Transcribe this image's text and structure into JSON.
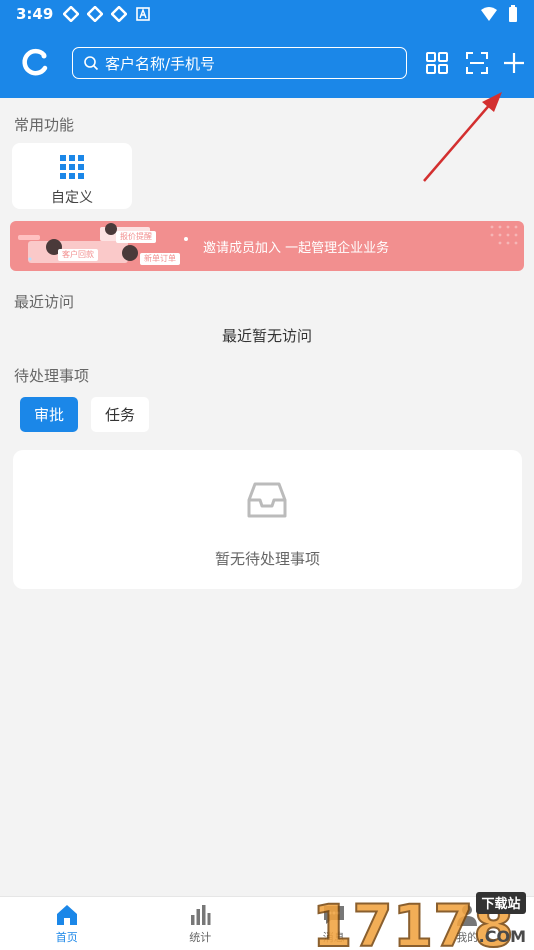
{
  "status_bar": {
    "time": "3:49"
  },
  "header": {
    "search_placeholder": "客户名称/手机号"
  },
  "common": {
    "title": "常用功能",
    "custom_label": "自定义"
  },
  "banner": {
    "text": "邀请成员加入  一起管理企业业务",
    "tag1": "报价提醒",
    "tag2": "客户回款",
    "tag3": "新单订单"
  },
  "recent": {
    "title": "最近访问",
    "empty_text": "最近暂无访问"
  },
  "pending": {
    "title": "待处理事项",
    "tabs": [
      {
        "label": "审批"
      },
      {
        "label": "任务"
      }
    ],
    "empty_text": "暂无待处理事项"
  },
  "nav": {
    "items": [
      {
        "label": "首页"
      },
      {
        "label": "统计"
      },
      {
        "label": "消息"
      },
      {
        "label": "我的"
      }
    ]
  },
  "watermark": {
    "logo": "17178",
    "sub1": "下载站",
    "sub2": ".COM"
  },
  "colors": {
    "primary": "#1b87e8",
    "banner": "#f28f8f",
    "background": "#f3f3f3",
    "arrow": "#d32f2f"
  },
  "icons": {
    "logo": "c-logo-icon",
    "search": "search-icon",
    "grid": "grid-icon",
    "scan": "scan-icon",
    "add": "plus-icon",
    "inbox": "inbox-icon",
    "home": "home-icon",
    "stats": "bar-chart-icon",
    "message": "message-icon",
    "user": "user-icon"
  }
}
